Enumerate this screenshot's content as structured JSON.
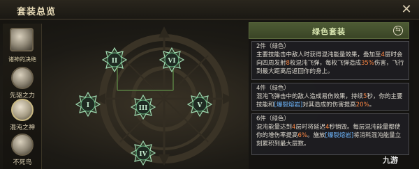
{
  "window": {
    "title": "套装总览",
    "close_icon": "✕"
  },
  "left_column": {
    "header": "诸神的决绝",
    "items": [
      {
        "label": "先驱之力",
        "icon": "emblem-icon",
        "selected": false
      },
      {
        "label": "混沌之神",
        "icon": "eye-emblem-icon",
        "selected": true
      },
      {
        "label": "不死鸟",
        "icon": "phoenix-icon",
        "selected": false
      }
    ]
  },
  "nodes": [
    {
      "numeral": "II",
      "color": "#3fa86a"
    },
    {
      "numeral": "VI",
      "color": "#3fa86a"
    },
    {
      "numeral": "I",
      "color": "#3fa86a"
    },
    {
      "numeral": "III",
      "color": "#3fa86a"
    },
    {
      "numeral": "V",
      "color": "#3fa86a"
    },
    {
      "numeral": "IV",
      "color": "#3fa86a"
    }
  ],
  "panel": {
    "set_name": "绿色套装",
    "bonuses": [
      {
        "title": "2件（绿色）",
        "segments": [
          {
            "t": "主要技能击中敌人时获得混沌能量效果，叠加至",
            "c": ""
          },
          {
            "t": "4",
            "c": "red"
          },
          {
            "t": "层时会向四周发射",
            "c": ""
          },
          {
            "t": "8",
            "c": "red"
          },
          {
            "t": "枚混沌飞弹，每枚飞弹造成",
            "c": ""
          },
          {
            "t": "35%",
            "c": "red"
          },
          {
            "t": "伤害，飞行到最大距离后返回你的身上。",
            "c": ""
          }
        ]
      },
      {
        "title": "4件（绿色）",
        "segments": [
          {
            "t": "混沌飞弹击中的敌人造成易伤效果，持续",
            "c": ""
          },
          {
            "t": "5",
            "c": "red"
          },
          {
            "t": "秒，你的主要技能和",
            "c": ""
          },
          {
            "t": "[爆裂熔岩]",
            "c": "blue"
          },
          {
            "t": "对其造成的伤害提高",
            "c": ""
          },
          {
            "t": "20%",
            "c": "red"
          },
          {
            "t": "。",
            "c": ""
          }
        ]
      },
      {
        "title": "6件（绿色）",
        "segments": [
          {
            "t": "混沌能量达到",
            "c": ""
          },
          {
            "t": "4",
            "c": "red"
          },
          {
            "t": "层时将延迟",
            "c": ""
          },
          {
            "t": "4",
            "c": "red"
          },
          {
            "t": "秒销毁。每层混沌能量都使你的增伤率提高",
            "c": ""
          },
          {
            "t": "6%",
            "c": "red"
          },
          {
            "t": "。施放",
            "c": ""
          },
          {
            "t": "[爆裂熔岩]",
            "c": "blue"
          },
          {
            "t": "将消耗混沌能量立刻累积到最大层数。",
            "c": ""
          }
        ]
      }
    ]
  },
  "watermark": "九游"
}
